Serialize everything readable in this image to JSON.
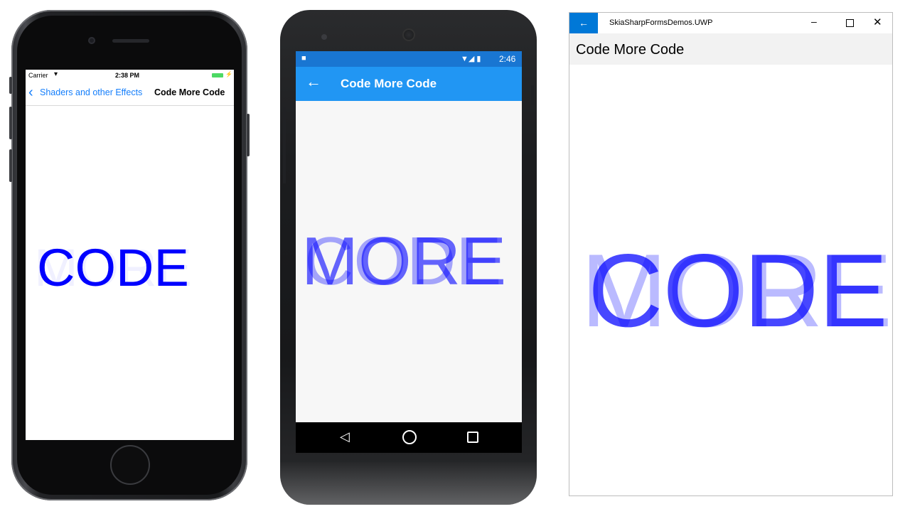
{
  "ios": {
    "status": {
      "carrier": "Carrier",
      "time": "2:38 PM"
    },
    "nav": {
      "back_label": "Shaders and other Effects",
      "title": "Code More Code"
    },
    "canvas": {
      "text_front": "CODE",
      "text_back": "MORE"
    }
  },
  "android": {
    "status": {
      "time": "2:46"
    },
    "appbar": {
      "title": "Code More Code"
    },
    "canvas": {
      "text_front": "MORE",
      "text_back": "CODE"
    }
  },
  "uwp": {
    "window_title": "SkiaSharpFormsDemos.UWP",
    "page_title": "Code More Code",
    "canvas": {
      "text_front": "CODE",
      "text_back": "MORE"
    }
  },
  "colors": {
    "text_blue": "#0000ff",
    "ios_link": "#147efb",
    "android_status": "#1976d2",
    "android_appbar": "#2196f3",
    "uwp_accent": "#0078d7"
  },
  "icons": {
    "ios_back": "chevron-left-icon",
    "android_back": "arrow-left-icon",
    "uwp_back": "arrow-left-icon"
  }
}
